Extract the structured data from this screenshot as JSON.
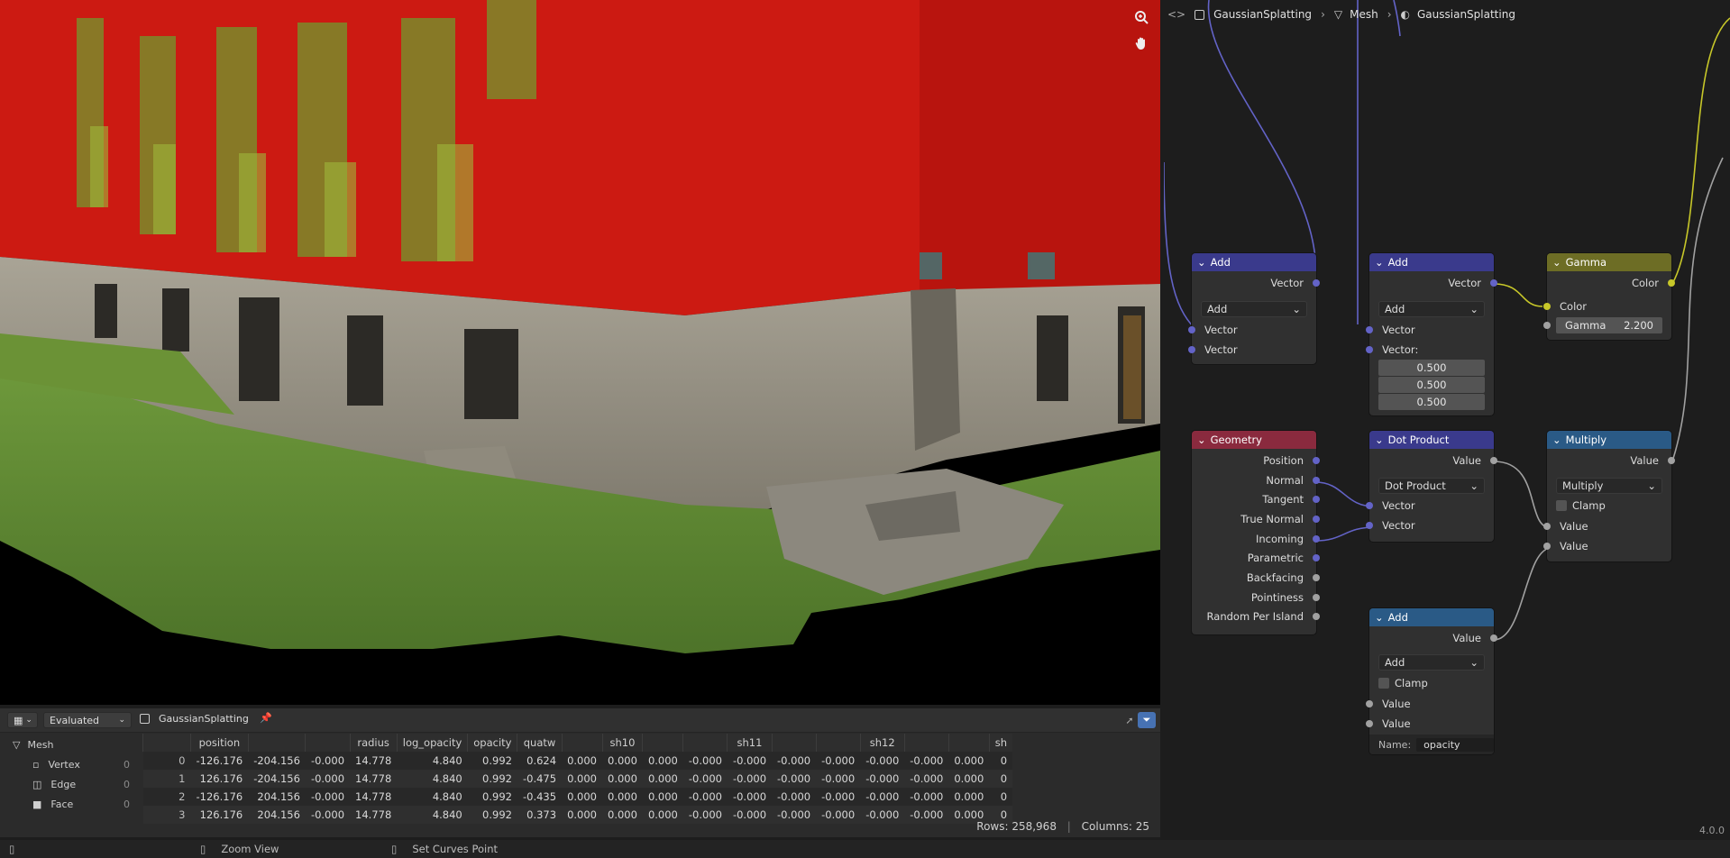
{
  "viewport": {
    "tools": {
      "zoom_icon": "zoom-icon",
      "pan_icon": "hand-icon"
    }
  },
  "spreadsheet": {
    "header": {
      "mode": "Evaluated",
      "object": "GaussianSplatting"
    },
    "sidebar": {
      "title": "Mesh",
      "items": [
        {
          "label": "Vertex",
          "count": "0"
        },
        {
          "label": "Edge",
          "count": "0"
        },
        {
          "label": "Face",
          "count": "0"
        }
      ]
    },
    "columns": [
      "",
      "position",
      "",
      "",
      "radius",
      "log_opacity",
      "opacity",
      "quatw",
      "",
      "sh10",
      "",
      "",
      "sh11",
      "",
      "",
      "sh12",
      "",
      "",
      "sh"
    ],
    "rows": [
      [
        "0",
        "-126.176",
        "-204.156",
        "-0.000",
        "14.778",
        "4.840",
        "0.992",
        "0.624",
        "0.000",
        "0.000",
        "0.000",
        "-0.000",
        "-0.000",
        "-0.000",
        "-0.000",
        "-0.000",
        "-0.000",
        "0.000",
        "0"
      ],
      [
        "1",
        "126.176",
        "-204.156",
        "-0.000",
        "14.778",
        "4.840",
        "0.992",
        "-0.475",
        "0.000",
        "0.000",
        "0.000",
        "-0.000",
        "-0.000",
        "-0.000",
        "-0.000",
        "-0.000",
        "-0.000",
        "0.000",
        "0"
      ],
      [
        "2",
        "-126.176",
        "204.156",
        "-0.000",
        "14.778",
        "4.840",
        "0.992",
        "-0.435",
        "0.000",
        "0.000",
        "0.000",
        "-0.000",
        "-0.000",
        "-0.000",
        "-0.000",
        "-0.000",
        "-0.000",
        "0.000",
        "0"
      ],
      [
        "3",
        "126.176",
        "204.156",
        "-0.000",
        "14.778",
        "4.840",
        "0.992",
        "0.373",
        "0.000",
        "0.000",
        "0.000",
        "-0.000",
        "-0.000",
        "-0.000",
        "-0.000",
        "-0.000",
        "-0.000",
        "0.000",
        "0"
      ]
    ],
    "footer": {
      "rows": "Rows: 258,968",
      "columns": "Columns: 25"
    }
  },
  "statusbar": {
    "items": [
      "Zoom View",
      "Set Curves Point"
    ],
    "version": "4.0.0"
  },
  "node_editor": {
    "breadcrumb": [
      "GaussianSplatting",
      "Mesh",
      "GaussianSplatting"
    ],
    "nodes": {
      "add1": {
        "title": "Add",
        "out": "Vector",
        "mode": "Add",
        "in1": "Vector",
        "in2": "Vector"
      },
      "add2": {
        "title": "Add",
        "out": "Vector",
        "mode": "Add",
        "in1": "Vector",
        "in2_label": "Vector:",
        "values": [
          "0.500",
          "0.500",
          "0.500"
        ]
      },
      "gamma": {
        "title": "Gamma",
        "out": "Color",
        "in1": "Color",
        "gamma_label": "Gamma",
        "gamma_value": "2.200"
      },
      "geometry": {
        "title": "Geometry",
        "outputs": [
          "Position",
          "Normal",
          "Tangent",
          "True Normal",
          "Incoming",
          "Parametric",
          "Backfacing",
          "Pointiness",
          "Random Per Island"
        ]
      },
      "dot": {
        "title": "Dot Product",
        "out": "Value",
        "mode": "Dot Product",
        "in1": "Vector",
        "in2": "Vector"
      },
      "multiply": {
        "title": "Multiply",
        "out": "Value",
        "mode": "Multiply",
        "clamp": "Clamp",
        "in1": "Value",
        "in2": "Value"
      },
      "add3": {
        "title": "Add",
        "out": "Value",
        "mode": "Add",
        "clamp": "Clamp",
        "in1": "Value",
        "in2": "Value",
        "name_label": "Name:",
        "name_value": "opacity"
      }
    }
  },
  "colors": {
    "vector_header": "#3a3a8c",
    "converter_header": "#2a5a86",
    "input_header": "#8a2a3e",
    "color_header": "#6d6d25",
    "vector_socket": "#6363c7",
    "color_socket": "#c7c729",
    "float_socket": "#a1a1a1"
  }
}
